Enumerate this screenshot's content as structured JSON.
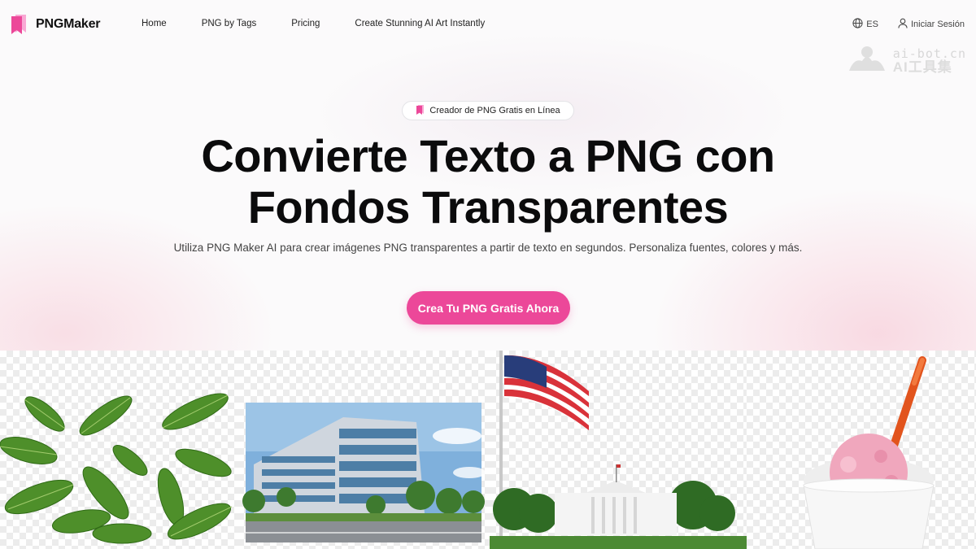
{
  "brand": {
    "name": "PNGMaker",
    "accent": "#ec4899"
  },
  "nav": {
    "links": [
      "Home",
      "PNG by Tags",
      "Pricing",
      "Create Stunning AI Art Instantly"
    ],
    "language": "ES",
    "login": "Iniciar Sesión"
  },
  "watermark": {
    "line1": "ai-bot.cn",
    "line2": "AI工具集"
  },
  "hero": {
    "badge": "Creador de PNG Gratis en Línea",
    "title_line1": "Convierte Texto a PNG con",
    "title_line2": "Fondos Transparentes",
    "subtitle": "Utiliza PNG Maker AI para crear imágenes PNG transparentes a partir de texto en segundos. Personaliza fuentes, colores y más.",
    "cta": "Crea Tu PNG Gratis Ahora"
  },
  "gallery": {
    "items": [
      "green leaves",
      "office building",
      "american flag and white house",
      "strawberry ice cream cup"
    ]
  },
  "icons": {
    "logo": "bookmark-logo-icon",
    "language": "globe-icon",
    "login": "user-icon",
    "badge": "bookmark-icon"
  }
}
